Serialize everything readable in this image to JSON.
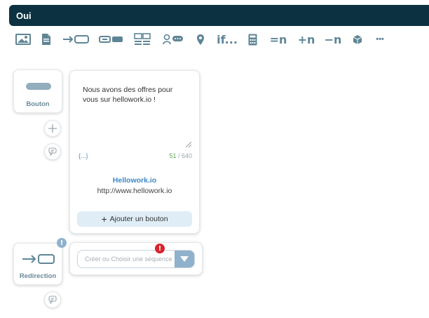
{
  "header": {
    "title": "Oui"
  },
  "toolbar": {
    "items": [
      {
        "name": "image-icon"
      },
      {
        "name": "document-icon"
      },
      {
        "name": "redirect-icon"
      },
      {
        "name": "button-icon"
      },
      {
        "name": "gallery-icon"
      },
      {
        "name": "user-input-icon"
      },
      {
        "name": "location-icon"
      },
      {
        "name": "condition",
        "label": "if..."
      },
      {
        "name": "calculator-icon"
      },
      {
        "name": "set-variable",
        "label": "=n"
      },
      {
        "name": "increment-variable",
        "label": "+n"
      },
      {
        "name": "decrement-variable",
        "label": "−n"
      },
      {
        "name": "plugin-icon"
      },
      {
        "name": "more",
        "label": "•••"
      }
    ]
  },
  "button_block": {
    "label": "Bouton"
  },
  "message": {
    "text": "Nous avons des offres pour vous sur hellowork.io !",
    "variable_button": "{...}",
    "char_used": "51",
    "char_max": "/ 640",
    "link_title": "Hellowork.io",
    "link_url": "http://www.hellowork.io",
    "add_button_label": "Ajouter un bouton"
  },
  "redirect_block": {
    "label": "Redirection",
    "badge": "!"
  },
  "sequence": {
    "placeholder": "Créer ou Choisir une séquence",
    "error_badge": "!"
  },
  "colors": {
    "header_bg": "#0c3140",
    "icon": "#5e8596",
    "accent_blue": "#3c87c4",
    "counter_ok": "#5ba84a",
    "error": "#d9232d",
    "info": "#8fb1cc"
  }
}
